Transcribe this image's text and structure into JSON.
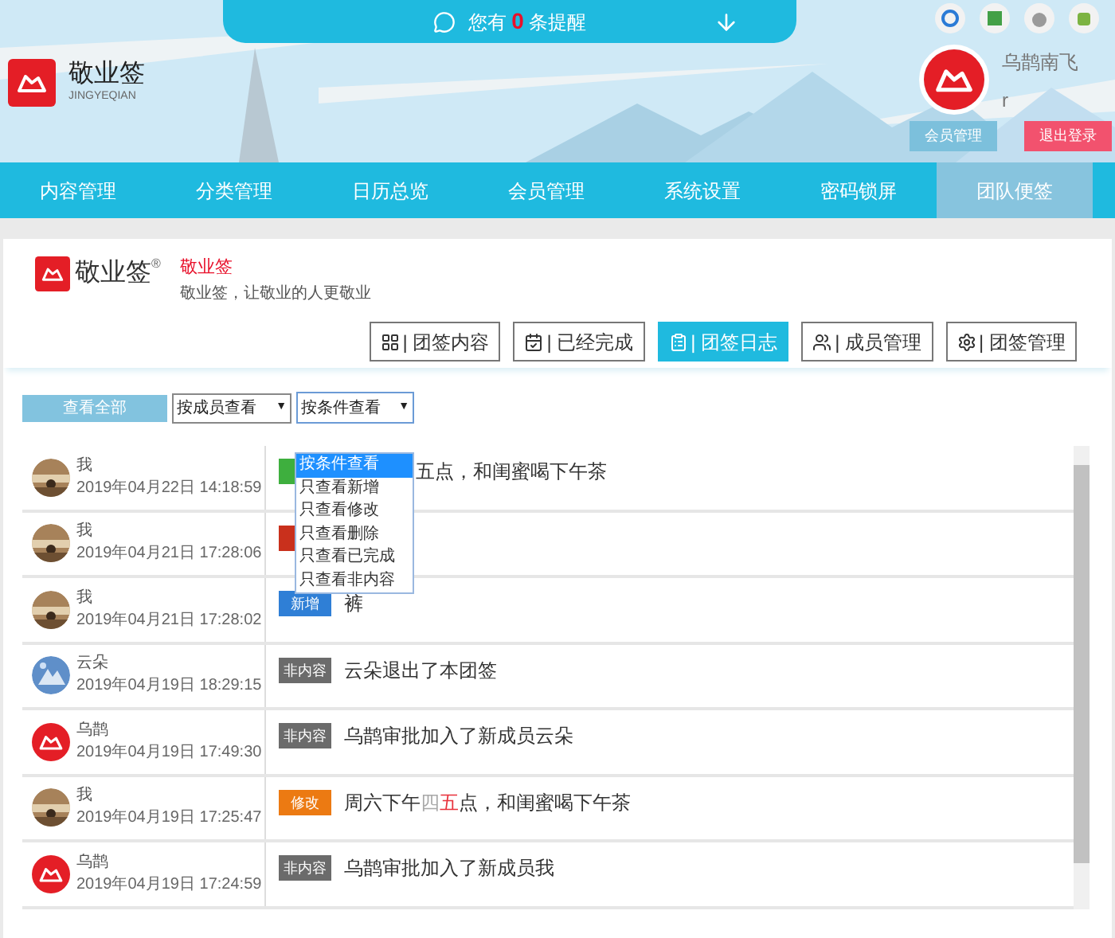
{
  "notice": {
    "prefix": "您有",
    "count": "0",
    "suffix": "条提醒"
  },
  "brand": {
    "name": "敬业签",
    "sub": "JINGYEQIAN"
  },
  "user": {
    "name": "乌鹊南飞",
    "account": "r",
    "buttons": [
      {
        "label": "会员管理",
        "kind": "member"
      },
      {
        "label": "退出登录",
        "kind": "logout"
      }
    ]
  },
  "nav": [
    {
      "label": "内容管理",
      "selected": false
    },
    {
      "label": "分类管理",
      "selected": false
    },
    {
      "label": "日历总览",
      "selected": false
    },
    {
      "label": "会员管理",
      "selected": false
    },
    {
      "label": "系统设置",
      "selected": false
    },
    {
      "label": "密码锁屏",
      "selected": false
    },
    {
      "label": "团队便签",
      "selected": true
    }
  ],
  "team": {
    "logo": "敬业签",
    "reg": "®",
    "title": "敬业签",
    "slogan": "敬业签，让敬业的人更敬业"
  },
  "actions": [
    {
      "label": "| 团签内容",
      "selected": false
    },
    {
      "label": "| 已经完成",
      "selected": false
    },
    {
      "label": "| 团签日志",
      "selected": true
    },
    {
      "label": "| 成员管理",
      "selected": false
    },
    {
      "label": "| 团签管理",
      "selected": false
    }
  ],
  "filters": {
    "all": "查看全部",
    "member": "按成员查看",
    "condition": "按条件查看",
    "arrow": "▼"
  },
  "dropdown": [
    {
      "label": "按条件查看",
      "selected": true
    },
    {
      "label": "只查看新增",
      "selected": false
    },
    {
      "label": "只查看修改",
      "selected": false
    },
    {
      "label": "只查看删除",
      "selected": false
    },
    {
      "label": "只查看已完成",
      "selected": false
    },
    {
      "label": "只查看非内容",
      "selected": false
    }
  ],
  "log": [
    {
      "user": "我",
      "time": "2019年04月22日 14:18:59",
      "color": "#3eaf3e",
      "parts": [
        {
          "text": "五点，和闺蜜喝下午茶",
          "kind": "normal"
        }
      ]
    },
    {
      "user": "我",
      "time": "2019年04月21日 17:28:06",
      "color": "#c9301c"
    },
    {
      "user": "我",
      "time": "2019年04月21日 17:28:02",
      "badge": "新增",
      "color": "#2f7fd6",
      "parts": [
        {
          "text": "裤",
          "kind": "normal"
        }
      ]
    },
    {
      "user": "云朵",
      "time": "2019年04月19日 18:29:15",
      "kind": "sky",
      "badge": "非内容",
      "color": "#6b6b6b",
      "parts": [
        {
          "text": "云朵退出了本团签",
          "kind": "normal"
        }
      ]
    },
    {
      "user": "乌鹊",
      "time": "2019年04月19日 17:49:30",
      "kind": "logo",
      "badge": "非内容",
      "color": "#6b6b6b",
      "parts": [
        {
          "text": "乌鹊审批加入了新成员云朵",
          "kind": "normal"
        }
      ]
    },
    {
      "user": "我",
      "time": "2019年04月19日 17:25:47",
      "badge": "修改",
      "color": "#ec7a12",
      "parts": [
        {
          "text": "周六下午",
          "kind": "normal"
        },
        {
          "text": "四",
          "kind": "deleted"
        },
        {
          "text": "五",
          "kind": "added"
        },
        {
          "text": "点，和闺蜜喝下午茶",
          "kind": "normal"
        }
      ]
    },
    {
      "user": "乌鹊",
      "time": "2019年04月19日 17:24:59",
      "kind": "logo",
      "badge": "非内容",
      "color": "#6b6b6b",
      "parts": [
        {
          "text": "乌鹊审批加入了新成员我",
          "kind": "normal"
        }
      ]
    }
  ]
}
